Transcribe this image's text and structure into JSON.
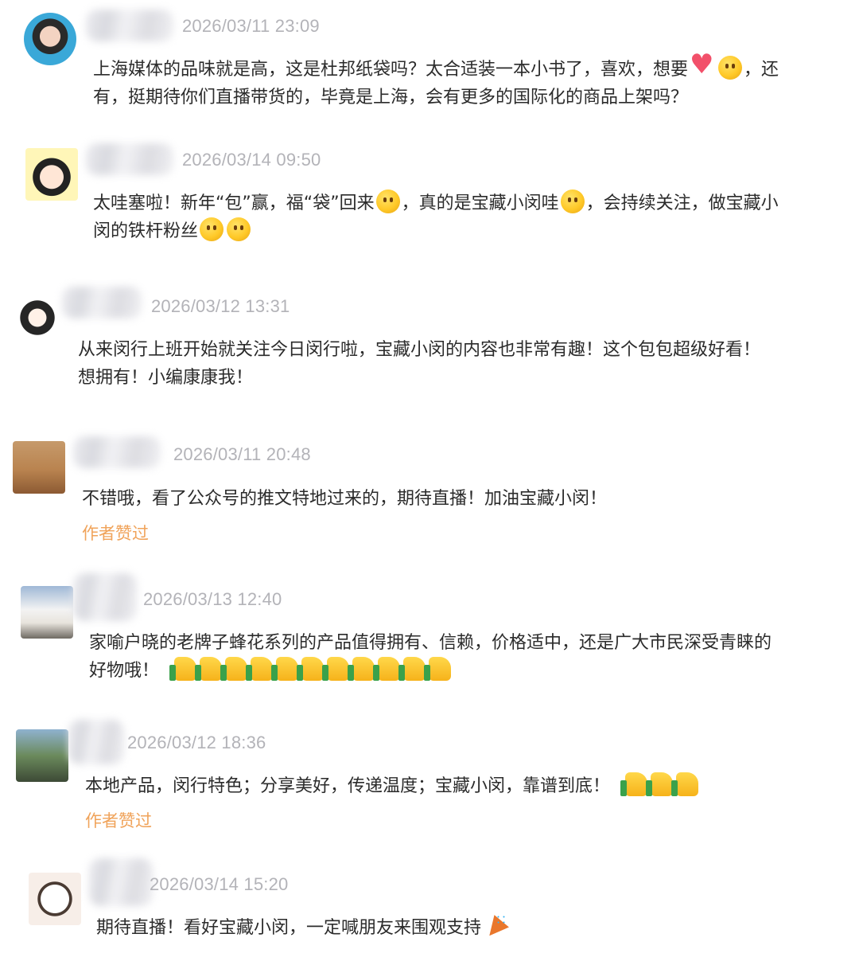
{
  "comments": [
    {
      "time": "2026/03/11 23:09",
      "lines": [
        "上海媒体的品味就是高，这是杜邦纸袋吗？太合适装一本小书了，喜欢，想要",
        "，还",
        "有，挺期待你们直播带货的，毕竟是上海，会有更多的国际化的商品上架吗？"
      ],
      "emojis": [
        "heart-emoji",
        "smiling-emoji"
      ]
    },
    {
      "time": "2026/03/14 09:50",
      "lines": [
        "太哇塞啦！新年“包”赢，福“袋”回来",
        "，真的是宝藏小闵哇",
        "，会持续关注，做宝藏小",
        "闵的铁杆粉丝"
      ],
      "emojis": [
        "surprised-emoji",
        "hush-emoji",
        "grin-emoji",
        "grin-emoji"
      ]
    },
    {
      "time": "2026/03/12 13:31",
      "lines": [
        "从来闵行上班开始就关注今日闵行啦，宝藏小闵的内容也非常有趣！这个包包超级好看！",
        "想拥有！小编康康我！"
      ]
    },
    {
      "time": "2026/03/11 20:48",
      "lines": [
        "不错哦，看了公众号的推文特地过来的，期待直播！加油宝藏小闵！"
      ],
      "liked": "作者赞过"
    },
    {
      "time": "2026/03/13 12:40",
      "lines": [
        "家喻户晓的老牌子蜂花系列的产品值得拥有、信赖，价格适中，还是广大市民深受青睐的",
        "好物哦！"
      ],
      "thumbs": 11
    },
    {
      "time": "2026/03/12 18:36",
      "lines": [
        "本地产品，闵行特色；分享美好，传递温度；宝藏小闵，靠谱到底！"
      ],
      "thumbs": 3,
      "liked": "作者赞过"
    },
    {
      "time": "2026/03/14 15:20",
      "lines": [
        "期待直播！看好宝藏小闵，一定喊朋友来围观支持"
      ],
      "emojis": [
        "party-popper-emoji"
      ]
    }
  ],
  "colors": {
    "timestamp": "#b3b3b8",
    "text": "#2b2b2b",
    "liked": "#f0a35a"
  }
}
